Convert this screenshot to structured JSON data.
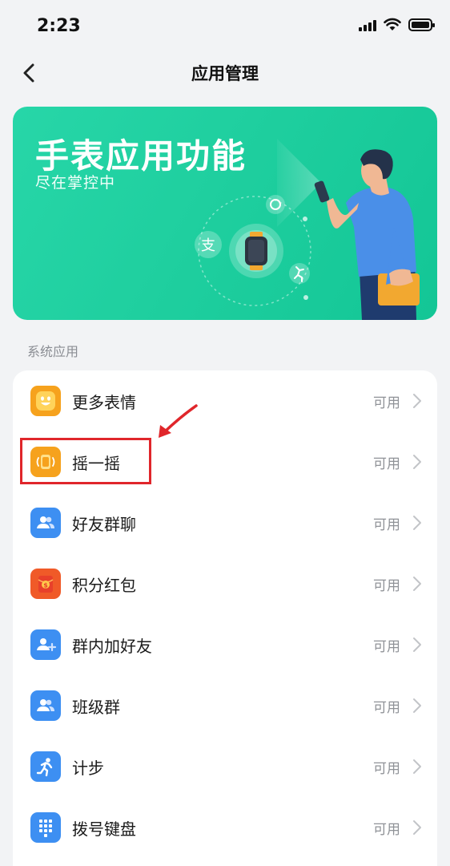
{
  "status_bar": {
    "time": "2:23",
    "icons": [
      "cellular-signal-icon",
      "wifi-icon",
      "battery-icon"
    ]
  },
  "nav": {
    "title": "应用管理",
    "back_icon": "chevron-left-icon"
  },
  "banner": {
    "title": "手表应用功能",
    "subtitle": "尽在掌控中",
    "background_color": "#1fcf9f"
  },
  "section": {
    "header": "系统应用"
  },
  "apps": [
    {
      "label": "更多表情",
      "status": "可用",
      "icon": "smiley-face-icon",
      "icon_color": "#f6a21d"
    },
    {
      "label": "摇一摇",
      "status": "可用",
      "icon": "shake-watch-icon",
      "icon_color": "#f6a21d"
    },
    {
      "label": "好友群聊",
      "status": "可用",
      "icon": "friends-group-icon",
      "icon_color": "#3d8ff2"
    },
    {
      "label": "积分红包",
      "status": "可用",
      "icon": "red-envelope-icon",
      "icon_color": "#f05a28"
    },
    {
      "label": "群内加好友",
      "status": "可用",
      "icon": "add-friend-icon",
      "icon_color": "#3d8ff2"
    },
    {
      "label": "班级群",
      "status": "可用",
      "icon": "class-group-icon",
      "icon_color": "#3d8ff2"
    },
    {
      "label": "计步",
      "status": "可用",
      "icon": "running-person-icon",
      "icon_color": "#3d8ff2"
    },
    {
      "label": "拨号键盘",
      "status": "可用",
      "icon": "dial-keypad-icon",
      "icon_color": "#3d8ff2"
    }
  ],
  "annotation": {
    "highlight_color": "#e0262b",
    "highlighted_item": "摇一摇"
  }
}
